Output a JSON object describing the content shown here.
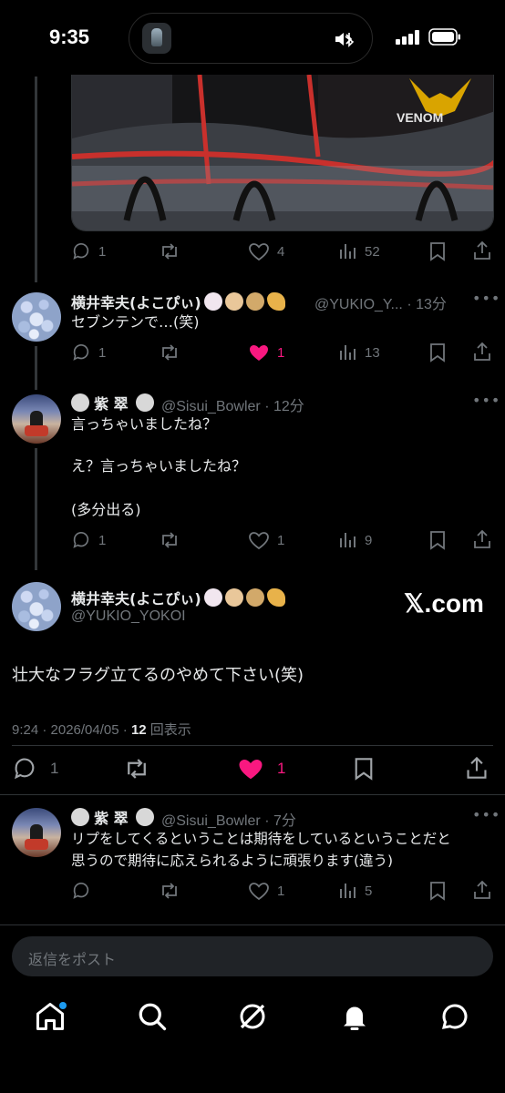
{
  "status_bar": {
    "time": "9:35"
  },
  "top_post": {
    "media_logo_text": "VENOM",
    "actions": {
      "replies": "1",
      "reposts": "",
      "likes": "4",
      "views": "52"
    }
  },
  "reply1": {
    "name": "横井幸夫(よこぴぃ)",
    "handle": "@YUKIO_Y...",
    "time": "· 13分",
    "text": "セブンテンで…(笑)",
    "actions": {
      "replies": "1",
      "likes": "1",
      "views": "13"
    }
  },
  "reply2": {
    "name": "紫 翠",
    "handle": "@Sisui_Bowler",
    "time": "· 12分",
    "lines": [
      "言っちゃいましたね？",
      "え？言っちゃいましたね？",
      "(多分出る)"
    ],
    "actions": {
      "replies": "1",
      "likes": "1",
      "views": "9"
    }
  },
  "focus_post": {
    "name": "横井幸夫(よこぴぃ)",
    "handle": "@YUKIO_YOKOI",
    "watermark": "𝕏.com",
    "text": "壮大なフラグ立てるのやめて下さい(笑)",
    "meta_time": "9:24 · 2026/04/05 · ",
    "meta_views_count": "12",
    "meta_views_label": " 回表示",
    "actions": {
      "replies": "1",
      "likes": "1"
    }
  },
  "reply3": {
    "name": "紫 翠",
    "handle": "@Sisui_Bowler",
    "time": "· 7分",
    "lines": [
      "リプをしてくるということは期待をしているということだと",
      "思うので期待に応えられるように頑張ります(違う)"
    ],
    "actions": {
      "replies": "",
      "likes": "1",
      "views": "5"
    }
  },
  "reply_box": {
    "placeholder": "返信をポスト"
  },
  "tabs": [
    "home-icon",
    "search-icon",
    "grok-icon",
    "notifications-icon",
    "messages-icon"
  ],
  "colors": {
    "like": "#f91880",
    "muted": "#71767b",
    "accent": "#1d9bf0",
    "bg": "#000000"
  }
}
